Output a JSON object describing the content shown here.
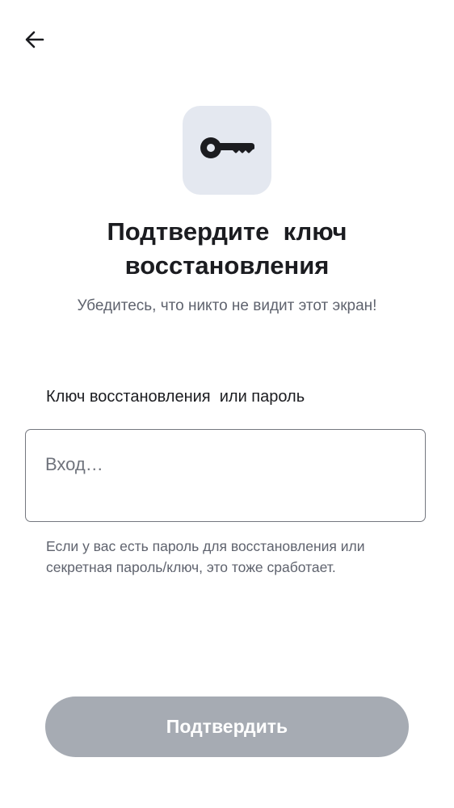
{
  "header": {
    "back_icon": "arrow-left-icon"
  },
  "hero": {
    "icon": "key-icon",
    "icon_tile_color": "#e4e8f0",
    "title": "Подтвердите  ключ\nвосстановления",
    "subtitle": "Убедитесь, что никто не видит этот экран!"
  },
  "form": {
    "label": "Ключ восстановления  или пароль",
    "input_value": "",
    "input_placeholder": "Вход…",
    "helper": "Если у вас есть пароль для восстановления или секретная пароль/ключ, это тоже сработает."
  },
  "actions": {
    "confirm_label": "Подтвердить",
    "confirm_color": "#a6abb3",
    "confirm_enabled": false
  }
}
